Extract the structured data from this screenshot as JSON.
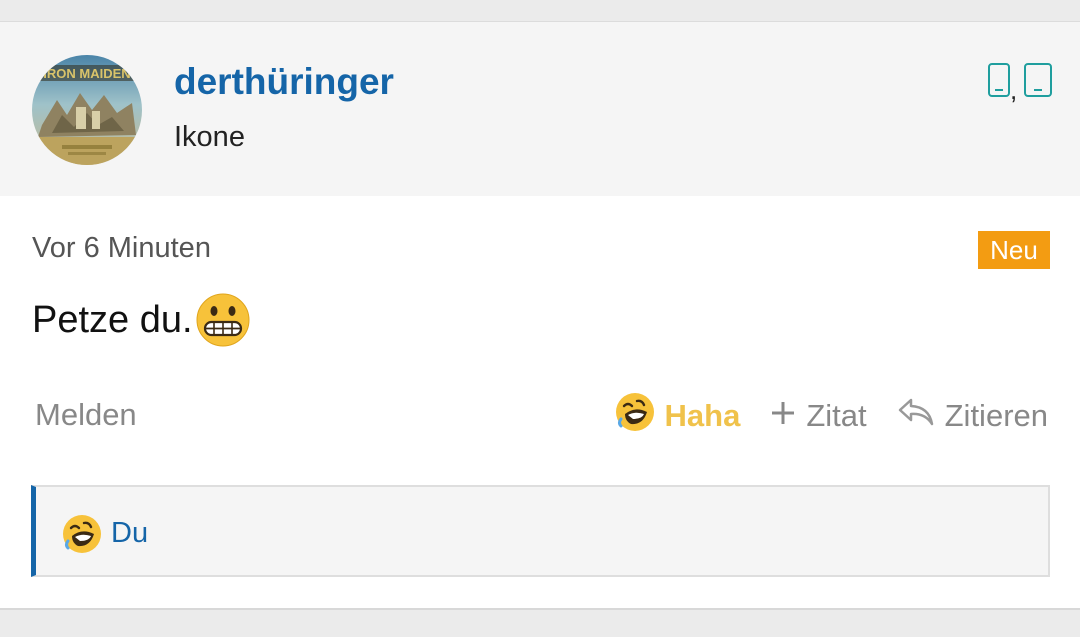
{
  "post": {
    "author": {
      "username": "derthüringer",
      "rank": "Ikone",
      "avatar_icon": "iron-maiden-album-avatar",
      "avatar_text": "IRON MAIDEN"
    },
    "device_icons": [
      "phone-icon",
      "tablet-icon"
    ],
    "device_separator": ",",
    "timestamp": "Vor 6 Minuten",
    "badge": "Neu",
    "message_text": "Petze du.",
    "message_emoji": "grimacing-face-emoji"
  },
  "actions": {
    "report_label": "Melden",
    "reaction_label": "Haha",
    "reaction_icon": "rofl-emoji",
    "quote_add_label": "Zitat",
    "quote_add_icon": "plus-icon",
    "reply_label": "Zitieren",
    "reply_icon": "reply-arrow-icon"
  },
  "reactions": {
    "icon": "rofl-emoji",
    "users": "Du"
  },
  "colors": {
    "link_blue": "#1565a8",
    "badge_orange": "#f39c12",
    "haha_yellow": "#f0c24b",
    "device_teal": "#1f9e9e"
  }
}
